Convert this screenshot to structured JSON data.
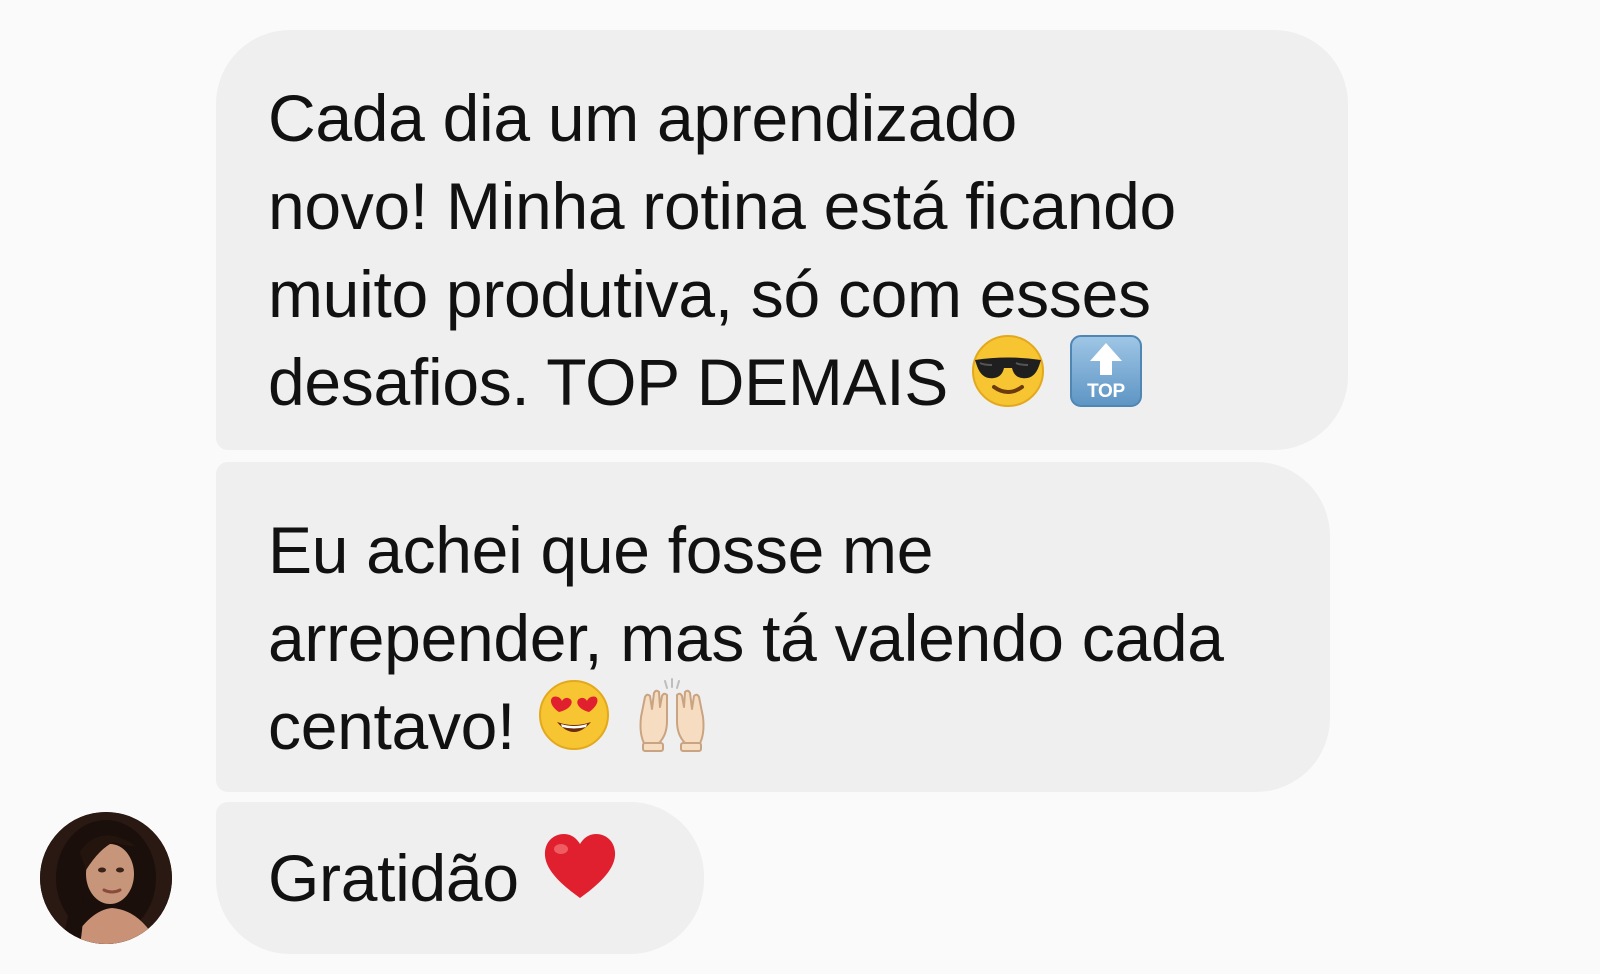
{
  "messages": [
    {
      "lines": [
        "Cada dia um aprendizado",
        "novo! Minha rotina está ficando",
        "muito produtiva, só com esses",
        "desafios. TOP DEMAIS"
      ],
      "emojis": [
        "smiling-face-with-sunglasses",
        "top-arrow"
      ]
    },
    {
      "lines": [
        "Eu achei que fosse me",
        "arrepender, mas tá valendo cada",
        "centavo!"
      ],
      "emojis": [
        "smiling-face-with-heart-eyes",
        "raising-hands"
      ]
    },
    {
      "lines": [
        "Gratidão"
      ],
      "emojis": [
        "red-heart"
      ]
    }
  ],
  "colors": {
    "background": "#fafafa",
    "bubble": "#efefef",
    "text": "#111111",
    "heart": "#e0202e"
  },
  "sender": {
    "avatar": "user-avatar"
  }
}
